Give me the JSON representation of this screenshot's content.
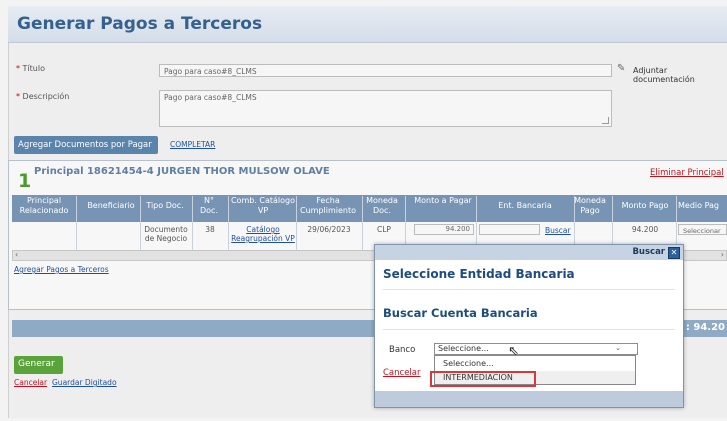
{
  "page": {
    "title": "Generar Pagos a Terceros"
  },
  "form": {
    "titulo_label": "Título",
    "titulo_value": "Pago para caso#8_CLMS",
    "attach_label": "Adjuntar documentación",
    "descripcion_label": "Descripción",
    "descripcion_value": "Pago para caso#8_CLMS",
    "required_mark": "*"
  },
  "actions": {
    "agregar_documentos": "Agregar Documentos por Pagar",
    "completar": "COMPLETAR",
    "agregar_pagos": "Agregar Pagos a Terceros",
    "generar": "Generar",
    "cancelar": "Cancelar",
    "guardar_digitado": "Guardar Digitado"
  },
  "principal": {
    "number": "1",
    "title": "Principal 18621454-4 JURGEN THOR MULSOW OLAVE",
    "eliminar": "Eliminar Principal"
  },
  "table": {
    "headers": [
      "Principal Relacionado",
      "Beneficiario",
      "Tipo Doc.",
      "N° Doc.",
      "Comb. Catálogo VP",
      "Fecha Cumplimiento",
      "Moneda Doc.",
      "Monto a Pagar",
      "Ent. Bancaria",
      "Moneda Pago",
      "Monto Pago",
      "Medio Pag"
    ],
    "row": {
      "tipo_doc": "Documento de Negocio",
      "n_doc": "38",
      "catalogo": "Catálogo Reagrupación VP",
      "fecha": "29/06/2023",
      "moneda": "CLP",
      "monto": "94.200",
      "buscar": "Buscar",
      "monto_pago": "94.200",
      "medio": "Seleccionar"
    }
  },
  "total": {
    "text": "P) : 94.20"
  },
  "modal": {
    "close_label": "Buscar",
    "heading": "Seleccione Entidad Bancaria",
    "subheading": "Buscar Cuenta Bancaria",
    "banco_label": "Banco",
    "select_value": "Seleccione...",
    "options": [
      "Seleccione...",
      "INTERMEDIACION"
    ],
    "cancelar": "Cancelar"
  }
}
